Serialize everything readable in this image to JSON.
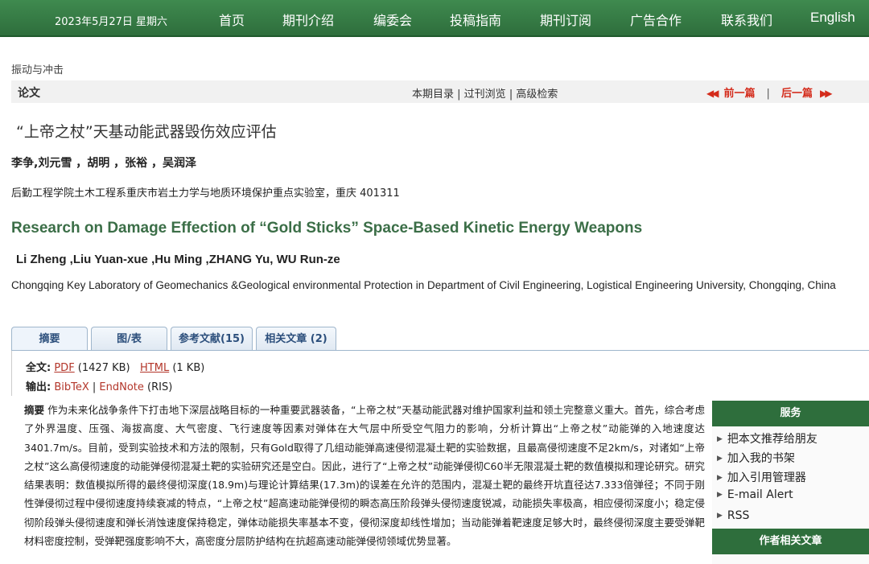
{
  "nav": {
    "date": "2023年5月27日 星期六",
    "items": [
      "首页",
      "期刊介绍",
      "编委会",
      "投稿指南",
      "期刊订阅",
      "广告合作",
      "联系我们",
      "English"
    ]
  },
  "breadcrumb": "振动与冲击",
  "bar": {
    "title": "论文",
    "issue_toc": "本期目录",
    "sep1": " | ",
    "past_issues": "过刊浏览",
    "sep2": " | ",
    "advanced_search": "高级检索",
    "prev_label": "前一篇",
    "next_label": "后一篇",
    "pager_sep": "|"
  },
  "article": {
    "cn_title": "“上帝之杖”天基动能武器毁伤效应评估",
    "cn_authors": "李争,刘元雪 ，胡明 ，张裕 ，吴润泽",
    "cn_affiliation": "后勤工程学院土木工程系重庆市岩土力学与地质环境保护重点实验室，重庆 401311",
    "en_title": "Research on Damage Effection of “Gold Sticks” Space-Based Kinetic Energy Weapons",
    "en_authors": "Li Zheng ,Liu Yuan-xue ,Hu Ming ,ZHANG Yu, WU Run-ze",
    "en_affiliation": "Chongqing Key Laboratory of Geomechanics &Geological environmental Protection in Department of Civil Engineering, Logistical Engineering University, Chongqing, China"
  },
  "tabs": [
    "摘要",
    "图/表",
    "参考文献(15)",
    "相关文章 (2)"
  ],
  "fulltext": {
    "label": "全文:",
    "pdf": "PDF",
    "pdf_size": " (1427 KB)",
    "html": "HTML",
    "html_size": " (1 KB)"
  },
  "export": {
    "label": "输出:",
    "bibtex": "BibTeX",
    "sep": " | ",
    "endnote": "EndNote",
    "ris": " (RIS)"
  },
  "abstract": {
    "label": "摘要",
    "text": "作为未来化战争条件下打击地下深层战略目标的一种重要武器装备，“上帝之杖”天基动能武器对维护国家利益和领土完整意义重大。首先，综合考虑了外界温度、压强、海拔高度、大气密度、飞行速度等因素对弹体在大气层中所受空气阻力的影响，分析计算出“上帝之杖”动能弹的入地速度达3401.7m/s。目前，受到实验技术和方法的限制，只有Gold取得了几组动能弹高速侵彻混凝土靶的实验数据，且最高侵彻速度不足2km/s，对诸如“上帝之杖”这么高侵彻速度的动能弹侵彻混凝土靶的实验研究还是空白。因此，进行了“上帝之杖”动能弹侵彻C60半无限混凝土靶的数值模拟和理论研究。研究结果表明：数值模拟所得的最终侵彻深度(18.9m)与理论计算结果(17.3m)的误差在允许的范围内，混凝土靶的最终开坑直径达7.333倍弹径；不同于刚性弹侵彻过程中侵彻速度持续衰减的特点，“上帝之杖”超高速动能弹侵彻的瞬态高压阶段弹头侵彻速度锐减，动能损失率极高，相应侵彻深度小；稳定侵彻阶段弹头侵彻速度和弹长消蚀速度保持稳定，弹体动能损失率基本不变，侵彻深度却线性增加；当动能弹着靶速度足够大时，最终侵彻深度主要受弹靶材料密度控制，受弹靶强度影响不大，高密度分层防护结构在抗超高速动能弹侵彻领域优势显著。"
  },
  "sidebar": {
    "services_title": "服务",
    "services": [
      "把本文推荐给朋友",
      "加入我的书架",
      "加入引用管理器",
      "E-mail Alert",
      "RSS"
    ],
    "related_title": "作者相关文章"
  },
  "colors": {
    "nav_green": "#2e6e3c",
    "title_green": "#3b6e47",
    "link_red": "#b3362a",
    "pager_red": "#d42b1b"
  }
}
